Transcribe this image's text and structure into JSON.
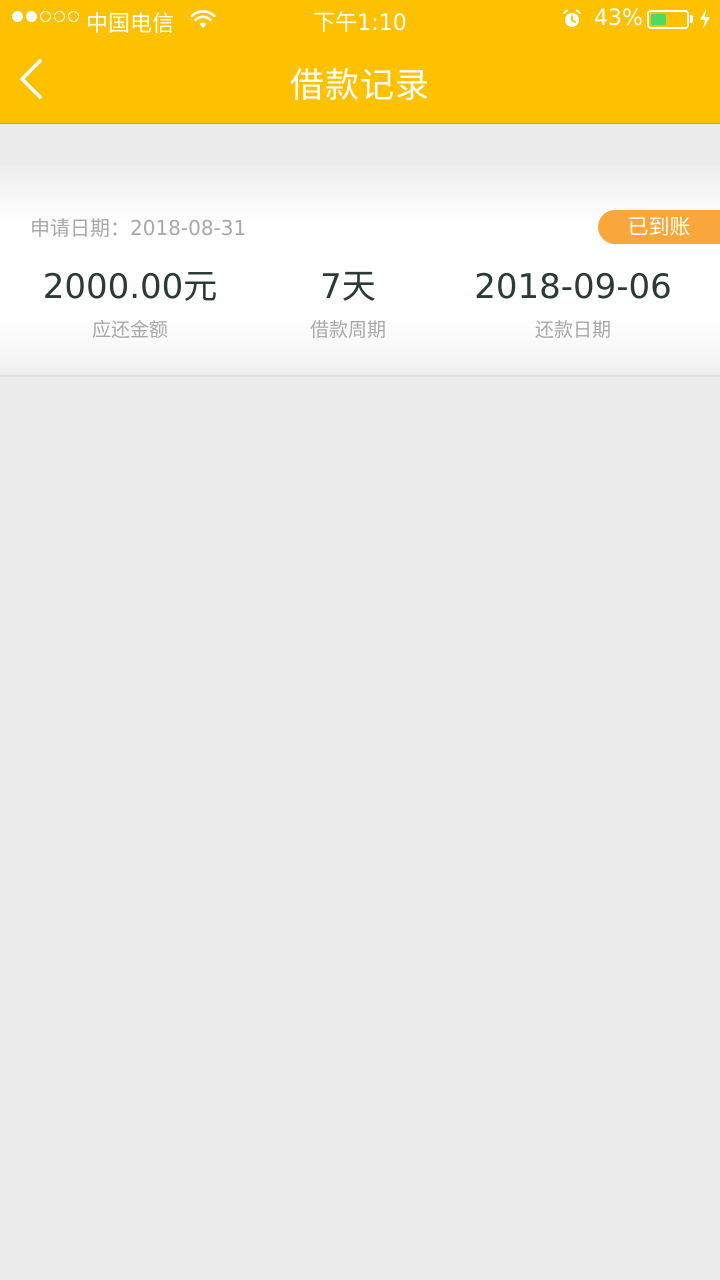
{
  "status_bar": {
    "carrier": "中国电信",
    "time": "下午1:10",
    "battery_percent": "43%",
    "battery_level": 0.43,
    "signal_bars_filled": 2,
    "signal_bars_total": 5,
    "colors": {
      "battery_fill": "#4cd964"
    }
  },
  "header": {
    "title": "借款记录",
    "back_icon": "chevron-left-icon",
    "background_color": "#fdc100"
  },
  "records": [
    {
      "apply_date_label": "申请日期：2018-08-31",
      "status": "已到账",
      "status_color": "#f9a73a",
      "amount_value": "2000.00元",
      "amount_label": "应还金额",
      "period_value": "7天",
      "period_label": "借款周期",
      "repay_date_value": "2018-09-06",
      "repay_date_label": "还款日期"
    }
  ]
}
